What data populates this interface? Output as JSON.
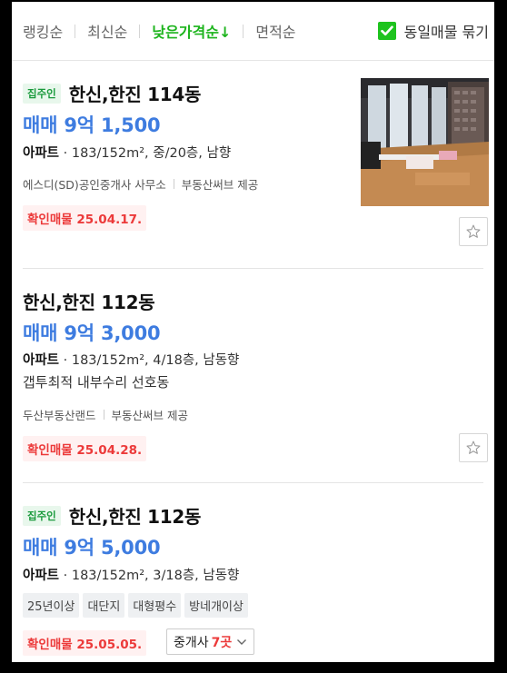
{
  "sort": {
    "options": [
      {
        "label": "랭킹순"
      },
      {
        "label": "최신순"
      },
      {
        "label": "낮은가격순↓"
      },
      {
        "label": "면적순"
      }
    ],
    "active_index": 2,
    "same_listing_toggle": {
      "label": "동일매물 묶기",
      "checked": true
    }
  },
  "listings": [
    {
      "owner_badge": "집주인",
      "title": "한신,한진 114동",
      "price": "매매 9억 1,500",
      "type": "아파트",
      "specs": "183/152m², 중/20층, 남향",
      "agencies": [
        "에스디(SD)공인중개사 사무소",
        "부동산써브 제공"
      ],
      "confirm": "확인매물 25.04.17."
    },
    {
      "title": "한신,한진 112동",
      "price": "매매 9억 3,000",
      "type": "아파트",
      "specs": "183/152m², 4/18층, 남동향",
      "description": "갭투최적 내부수리 선호동",
      "agencies": [
        "두산부동산랜드",
        "부동산써브 제공"
      ],
      "confirm": "확인매물 25.04.28."
    },
    {
      "owner_badge": "집주인",
      "title": "한신,한진 112동",
      "price": "매매 9억 5,000",
      "type": "아파트",
      "specs": "183/152m², 3/18층, 남동향",
      "tags": [
        "25년이상",
        "대단지",
        "대형평수",
        "방네개이상"
      ],
      "confirm": "확인매물 25.05.05.",
      "broker_button": {
        "label": "중개사",
        "count": "7곳"
      }
    }
  ],
  "colors": {
    "accent_green": "#1db41d",
    "price_blue": "#3e7ce0",
    "confirm_red": "#ec3a3a"
  }
}
